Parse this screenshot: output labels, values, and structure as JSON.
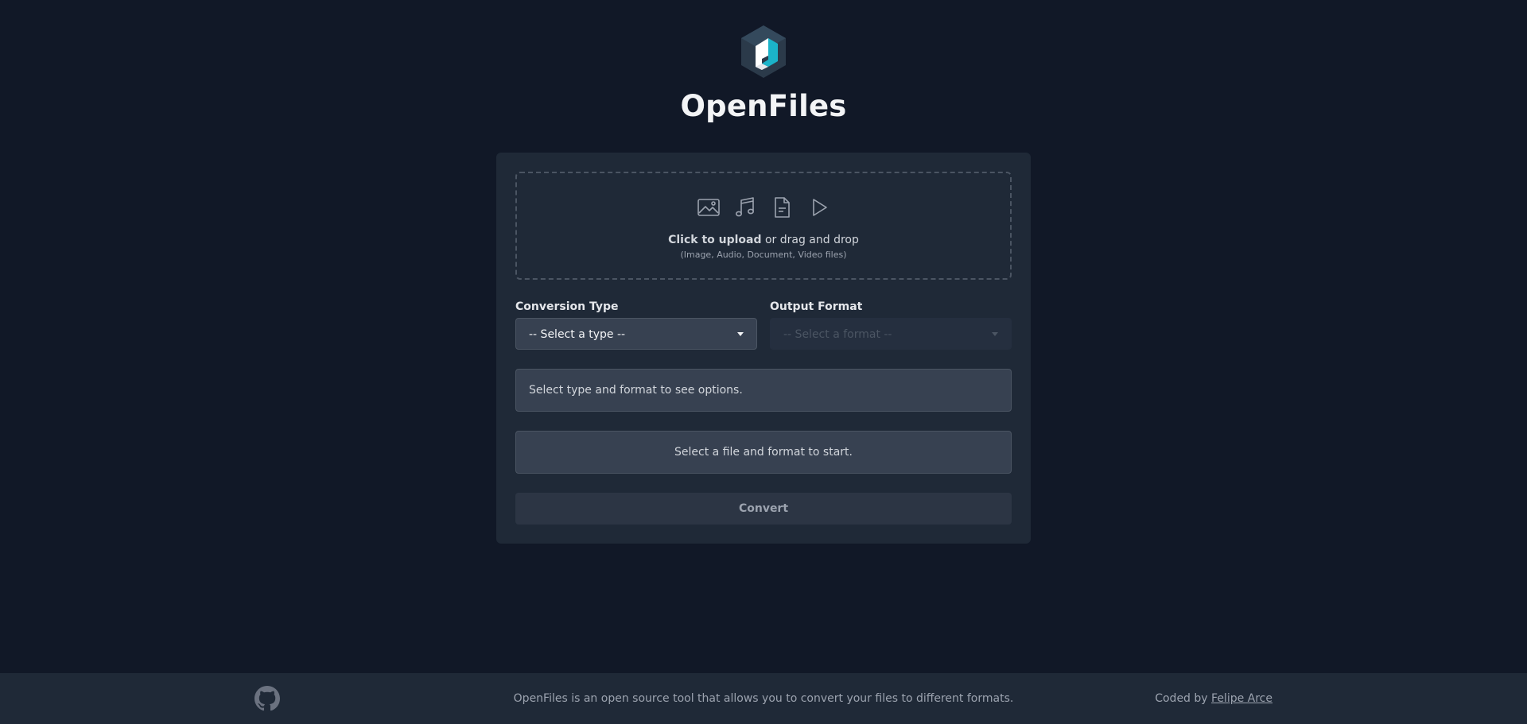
{
  "header": {
    "logo_icon": "openfiles-cube-logo",
    "title": "OpenFiles"
  },
  "upload": {
    "icons": [
      "image-icon",
      "music-icon",
      "document-icon",
      "play-icon"
    ],
    "click_text": "Click to upload",
    "drag_text": " or drag and drop",
    "hint": "(Image, Audio, Document, Video files)"
  },
  "conversion_type": {
    "label": "Conversion Type",
    "selected": "-- Select a type --"
  },
  "output_format": {
    "label": "Output Format",
    "selected": "-- Select a format --"
  },
  "options_text": "Select type and format to see options.",
  "status_text": "Select a file and format to start.",
  "convert_label": "Convert",
  "footer": {
    "github_icon": "github-icon",
    "description": "OpenFiles is an open source tool that allows you to convert your files to different formats.",
    "credit_prefix": "Coded by ",
    "credit_name": "Felipe Arce"
  },
  "colors": {
    "background": "#111827",
    "card": "#1f2937",
    "input": "#374151",
    "accent": "#1bb3c9"
  }
}
